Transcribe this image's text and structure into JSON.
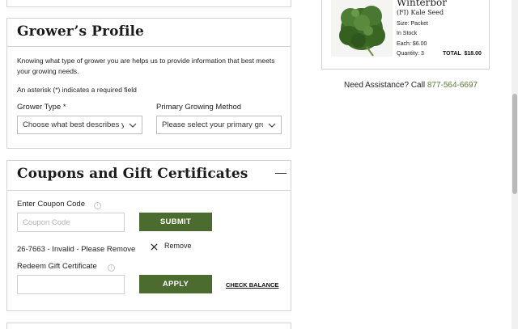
{
  "grower_profile": {
    "title": "Grower’s Profile",
    "intro": "Knowing what type of grower you are helps us to provide information that best meets your growing needs.",
    "required_note": "An asterisk (*) indicates a required field",
    "grower_type_label": "Grower Type *",
    "grower_type_value": "Choose what best describes you",
    "growing_method_label": "Primary Growing Method",
    "growing_method_value": "Please select your primary growing method"
  },
  "coupons": {
    "title": "Coupons and Gift Certificates",
    "collapse_symbol": "—",
    "coupon_label": "Enter Coupon Code",
    "coupon_placeholder": "Coupon Code",
    "submit_label": "SUBMIT",
    "applied_coupon": "26-7663 - Invalid - Please Remove",
    "remove_label": "Remove",
    "gift_label": "Redeem Gift Certificate",
    "gift_value": "",
    "apply_label": "APPLY",
    "check_balance_label": "CHECK BALANCE"
  },
  "cart_item": {
    "name": "Winterbor",
    "subtitle": "(FI) Kale Seed",
    "size": "Size: Packet",
    "stock": "In Stock",
    "each": "Each: $6.00",
    "quantity": "Quantity: 3",
    "total": "TOTAL  $18.00"
  },
  "assistance": {
    "text": "Need Assistance? Call",
    "phone": "877-564-6697"
  },
  "colors": {
    "accent_green": "#4b6b2f",
    "phone_green": "#5b7a3a",
    "border": "#d3d3d3"
  },
  "icons": {
    "chevron": "chevron-down-icon",
    "info": "info-icon",
    "remove": "close-icon",
    "product": "kale-image"
  }
}
